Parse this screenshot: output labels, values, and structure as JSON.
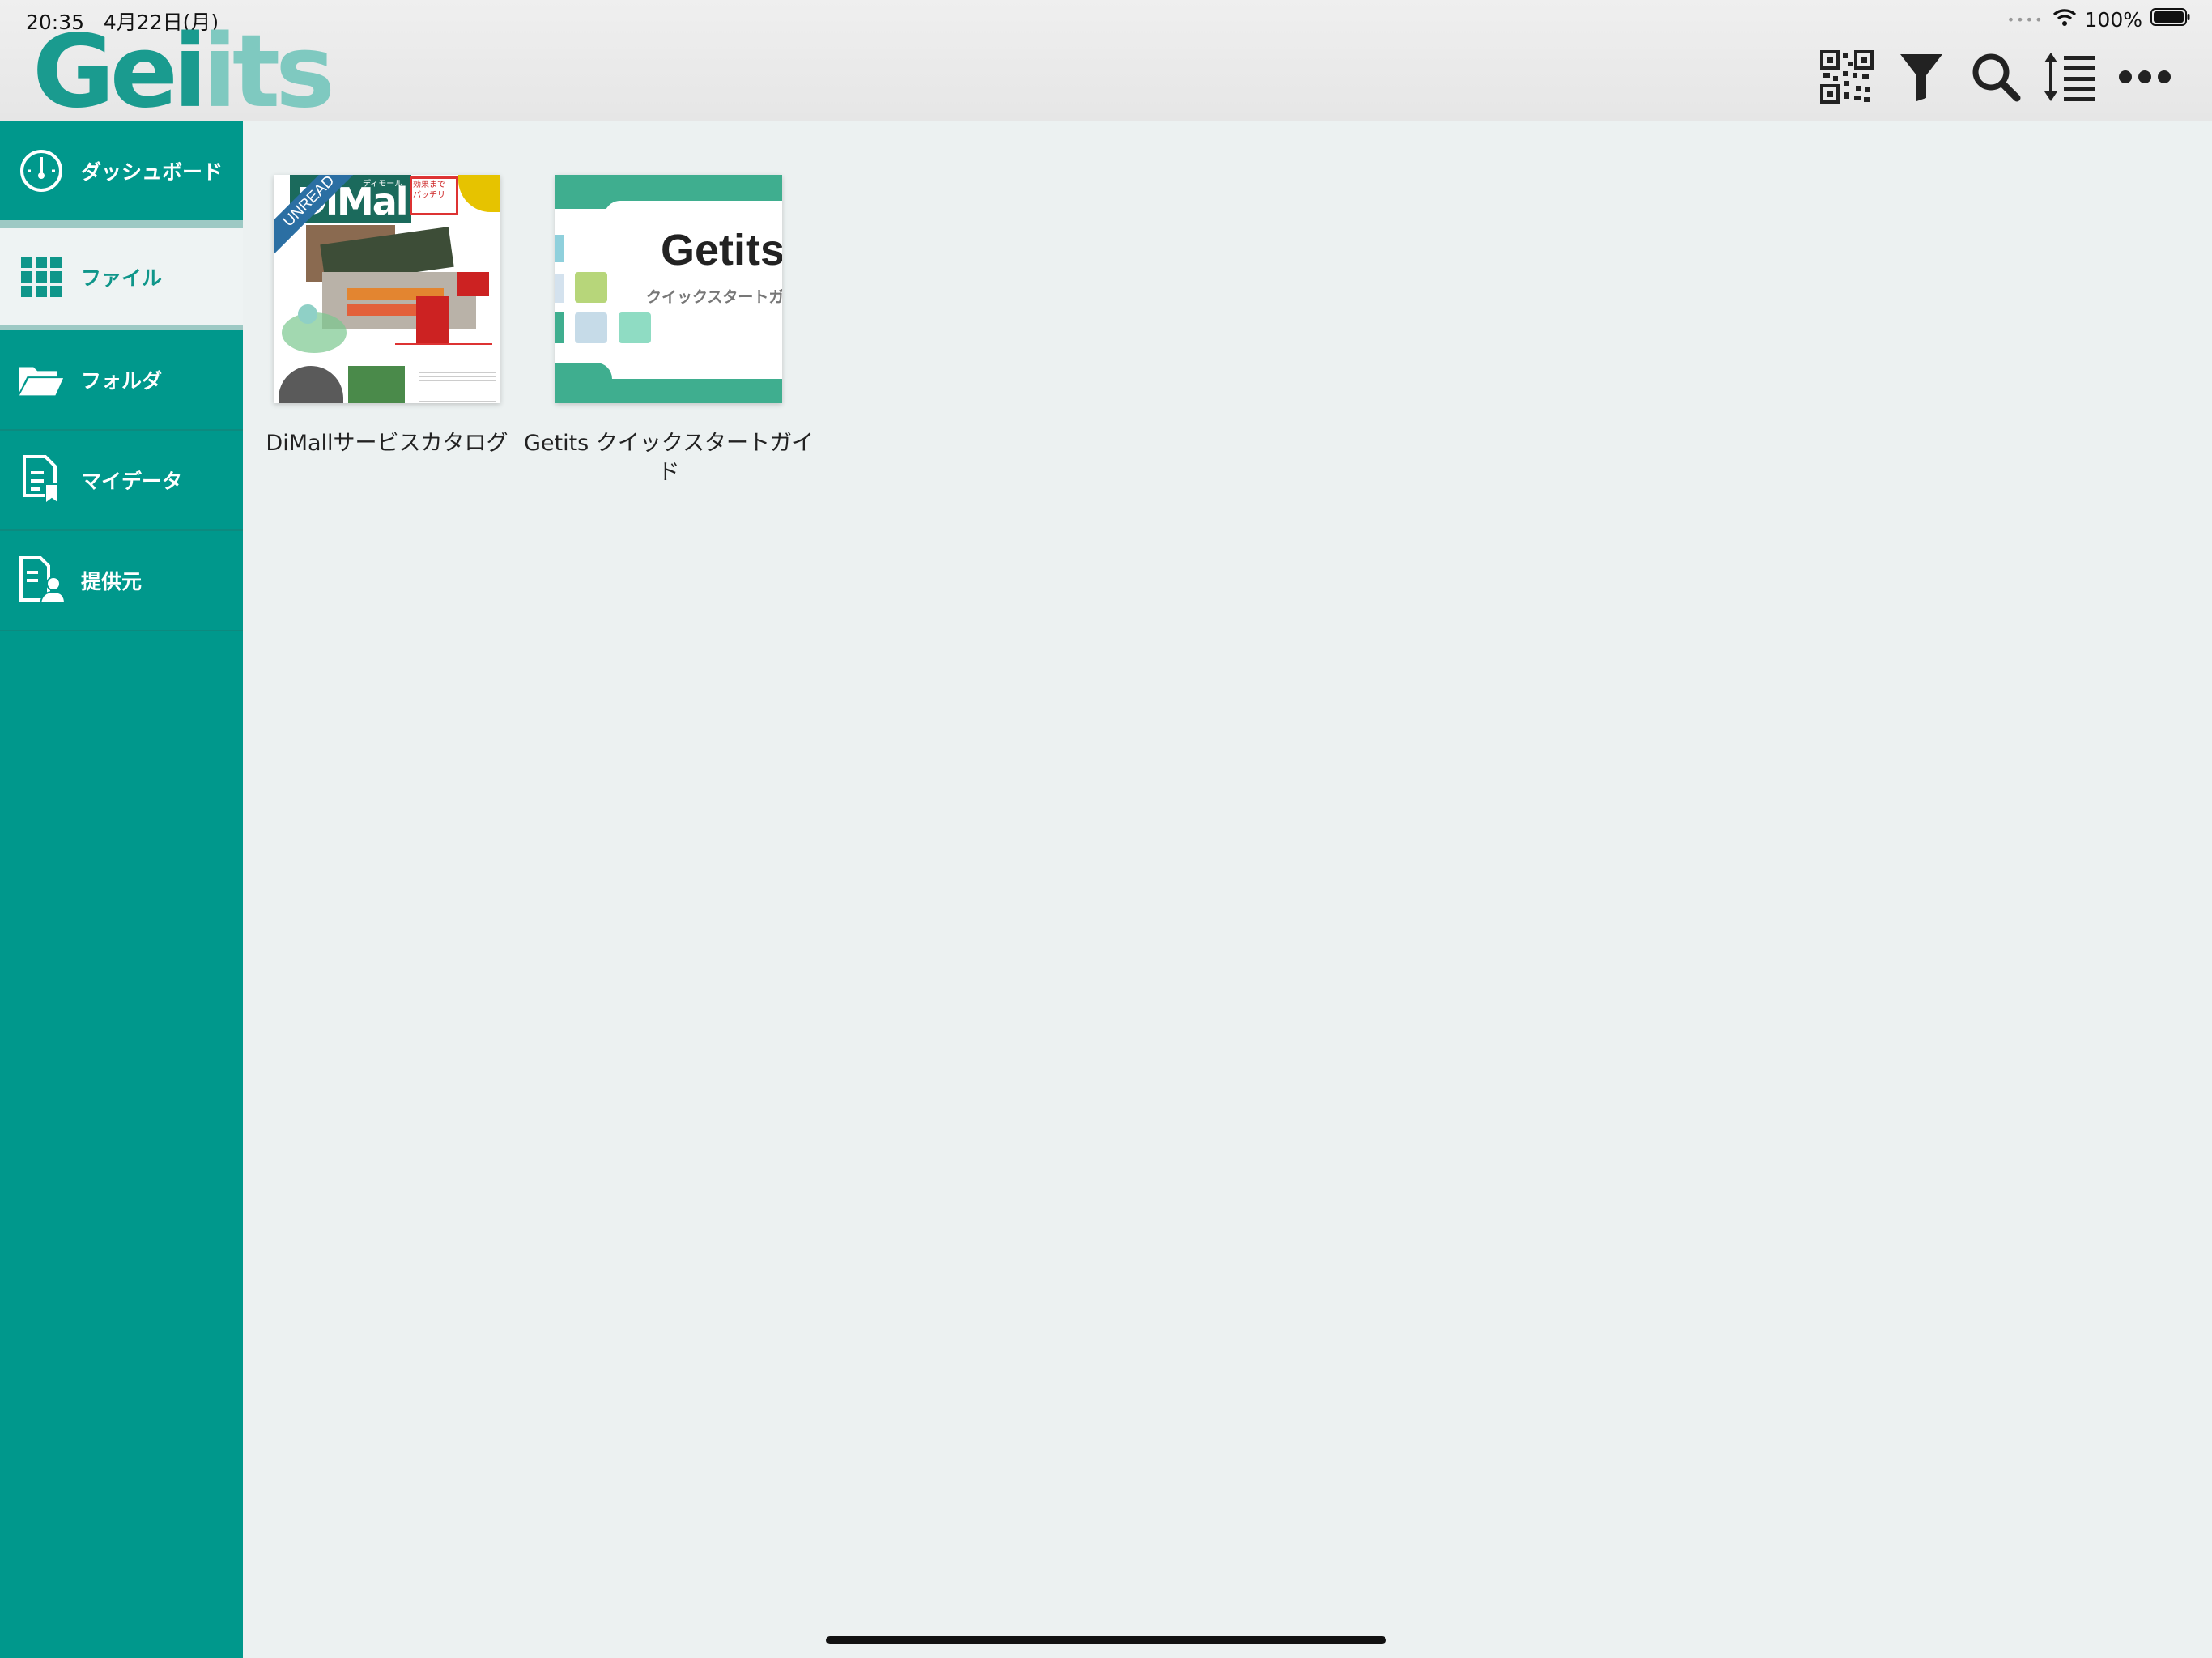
{
  "status": {
    "time": "20:35",
    "date": "4月22日(月)",
    "battery": "100%",
    "signal_icon": "signal-dots-icon",
    "wifi_icon": "wifi-icon",
    "battery_icon": "battery-icon"
  },
  "app": {
    "logo_part1": "Gei",
    "logo_part2": "its"
  },
  "toolbar": {
    "icons": [
      "qr-code-icon",
      "filter-icon",
      "search-icon",
      "sort-icon",
      "more-icon"
    ]
  },
  "sidebar": {
    "items": [
      {
        "label": "ダッシュボード",
        "icon": "dashboard-icon"
      },
      {
        "label": "ファイル",
        "icon": "grid-icon"
      },
      {
        "label": "フォルダ",
        "icon": "folder-icon"
      },
      {
        "label": "マイデータ",
        "icon": "my-data-icon"
      },
      {
        "label": "提供元",
        "icon": "provider-icon"
      }
    ]
  },
  "files": [
    {
      "name": "DiMallサービスカタログ",
      "badge": "UNREAD",
      "thumb_title": "DiMall",
      "thumb_tag": "ディモール",
      "thumb_note": "効果まで\nバッチリ"
    },
    {
      "name": "Getits クイックスタートガイド",
      "thumb_title": "Getits",
      "thumb_subtitle": "クイックスタートガ"
    }
  ],
  "colors": {
    "accent": "#00988c",
    "logo_light": "#7fc9c0",
    "background": "#ecf1f1"
  }
}
